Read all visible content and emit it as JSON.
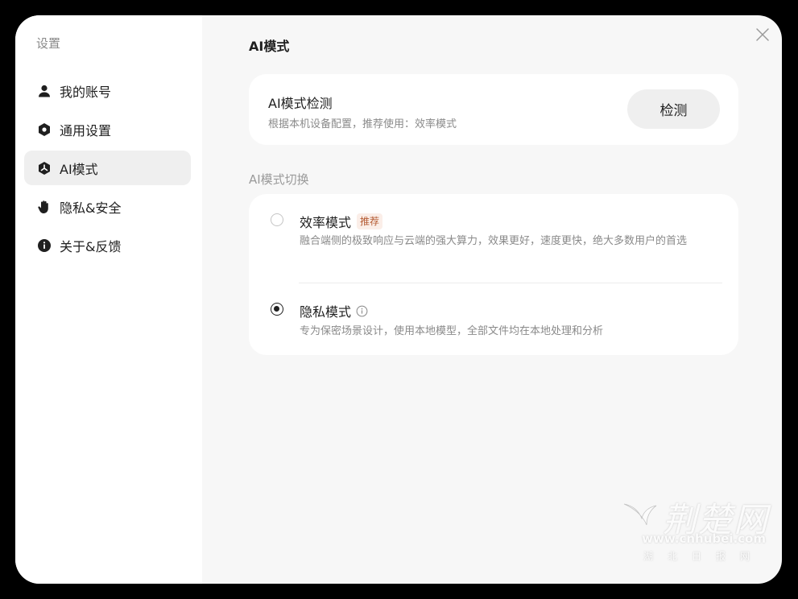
{
  "sidebar": {
    "title": "设置",
    "items": [
      {
        "label": "我的账号",
        "icon": "person-icon"
      },
      {
        "label": "通用设置",
        "icon": "hexagon-settings-icon"
      },
      {
        "label": "AI模式",
        "icon": "ai-mode-icon",
        "active": true
      },
      {
        "label": "隐私&安全",
        "icon": "hand-icon"
      },
      {
        "label": "关于&反馈",
        "icon": "info-circle-icon"
      }
    ]
  },
  "main": {
    "title": "AI模式",
    "detect": {
      "title": "AI模式检测",
      "description": "根据本机设备配置，推荐使用：效率模式",
      "button": "检测"
    },
    "switch_label": "AI模式切换",
    "modes": [
      {
        "name": "效率模式",
        "badge": "推荐",
        "description": "融合端侧的极致响应与云端的强大算力，效果更好，速度更快，绝大多数用户的首选",
        "selected": false
      },
      {
        "name": "隐私模式",
        "description": "专为保密场景设计，使用本地模型，全部文件均在本地处理和分析",
        "selected": true
      }
    ]
  },
  "watermark": {
    "logo": "荆楚网",
    "url": "www.cnhubei.com",
    "subtitle": "湖北日报网"
  },
  "colors": {
    "badge_text": "#b45a32",
    "badge_bg": "#fbeee8",
    "active_nav_bg": "#efefef",
    "window_bg": "#f7f7f7"
  }
}
